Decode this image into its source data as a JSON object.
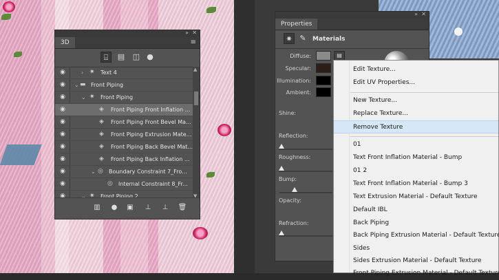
{
  "panel3d": {
    "tab": "3D",
    "layers": [
      {
        "label": "Text 4",
        "indent": 0,
        "expanded": false,
        "type": "scene"
      },
      {
        "label": "Front Piping",
        "indent": 0,
        "expanded": true,
        "type": "folder"
      },
      {
        "label": "Front Piping",
        "indent": 1,
        "expanded": true,
        "type": "mesh"
      },
      {
        "label": "Front Piping Front Inflation ...",
        "indent": 2,
        "selected": true,
        "type": "material"
      },
      {
        "label": "Front Piping Front Bevel Ma...",
        "indent": 2,
        "type": "material"
      },
      {
        "label": "Front Piping Extrusion Mate...",
        "indent": 2,
        "type": "material"
      },
      {
        "label": "Front Piping Back Bevel Mat...",
        "indent": 2,
        "type": "material"
      },
      {
        "label": "Front Piping Back Inflation ...",
        "indent": 2,
        "type": "material"
      },
      {
        "label": "Boundary Constraint 7_Fro...",
        "indent": 2,
        "expanded": true,
        "type": "constraint"
      },
      {
        "label": "Internal Constraint 8_Fr...",
        "indent": 3,
        "type": "constraint"
      },
      {
        "label": "Front Piping 2",
        "indent": 1,
        "expanded": true,
        "type": "mesh"
      }
    ]
  },
  "properties": {
    "tab": "Properties",
    "section": "Materials",
    "labels": {
      "diffuse": "Diffuse:",
      "specular": "Specular:",
      "illumination": "Illumination:",
      "ambient": "Ambient:",
      "shine": "Shine:",
      "reflection": "Reflection:",
      "roughness": "Roughness:",
      "bump": "Bump:",
      "opacity": "Opacity:",
      "refraction": "Refraction:"
    },
    "colors": {
      "diffuse": "#8a8a8a",
      "specular": "#2a1e16",
      "illumination": "#000000",
      "ambient": "#000000"
    }
  },
  "context_menu": {
    "items": [
      {
        "label": "Edit Texture..."
      },
      {
        "label": "Edit UV Properties..."
      },
      {
        "label": "New Texture..."
      },
      {
        "label": "Replace Texture..."
      },
      {
        "label": "Remove Texture",
        "hover": true
      },
      {
        "label": "01"
      },
      {
        "label": "Text Front Inflation Material - Bump"
      },
      {
        "label": "01 2"
      },
      {
        "label": "Text Front Inflation Material - Bump 3"
      },
      {
        "label": "Text Extrusion Material - Default Texture"
      },
      {
        "label": "Default IBL"
      },
      {
        "label": "Back Piping"
      },
      {
        "label": "Back Piping Extrusion Material - Default Texture"
      },
      {
        "label": "Sides"
      },
      {
        "label": "Sides Extrusion Material - Default Texture"
      },
      {
        "label": "Front Piping Extrusion Material - Default Texture"
      }
    ]
  }
}
